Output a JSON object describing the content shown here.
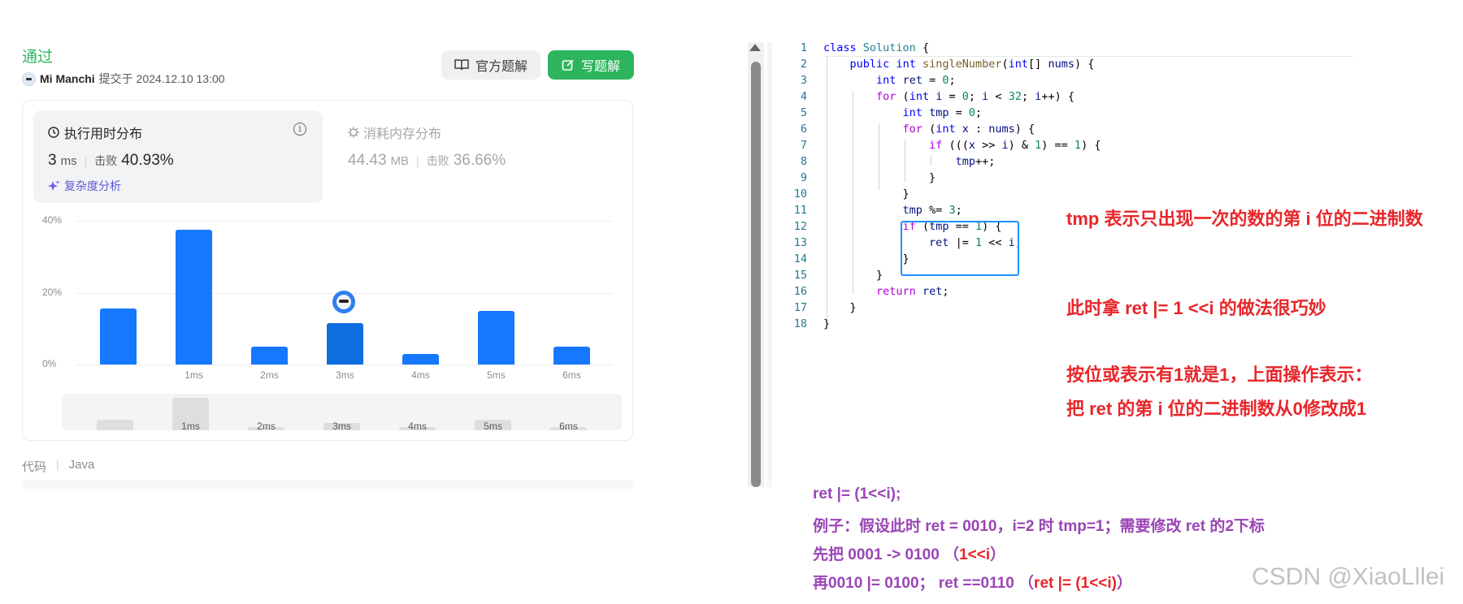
{
  "submission": {
    "status": "通过",
    "author": "Mi Manchi",
    "submitted_at": "提交于 2024.12.10 13:00",
    "official_solution_label": "官方题解",
    "write_solution_label": "写题解"
  },
  "runtime": {
    "title": "执行用时分布",
    "value": "3",
    "unit": "ms",
    "beats_label": "击败",
    "beats_value": "40.93%",
    "complexity_label": "复杂度分析"
  },
  "memory": {
    "title": "消耗内存分布",
    "value": "44.43",
    "unit": "MB",
    "beats_label": "击败",
    "beats_value": "36.66%"
  },
  "chart_data": {
    "type": "bar",
    "categories": [
      "",
      "1ms",
      "2ms",
      "3ms",
      "4ms",
      "5ms",
      "6ms"
    ],
    "values": [
      15.5,
      37.5,
      5,
      11.5,
      3,
      15,
      5
    ],
    "highlighted_category": "3ms",
    "yticks": [
      "40%",
      "20%",
      "0%"
    ],
    "ylim": [
      0,
      40
    ],
    "mini_values": [
      3,
      9,
      1,
      2,
      1,
      3,
      1
    ],
    "grid": true
  },
  "code_meta": {
    "label": "代码",
    "language": "Java"
  },
  "code_lines": [
    "1",
    "2",
    "3",
    "4",
    "5",
    "6",
    "7",
    "8",
    "9",
    "10",
    "11",
    "12",
    "13",
    "14",
    "15",
    "16",
    "17",
    "18"
  ],
  "annotations": {
    "tmp_note": "tmp 表示只出现一次的数的第 i 位的二进制数",
    "trick_note": "此时拿 ret |= 1 <<i 的做法很巧妙",
    "or_note_1": "按位或表示有1就是1，上面操作表示：",
    "or_note_2": "把 ret 的第 i 位的二进制数从0修改成1",
    "ex_line1": "ret |= (1<<i);",
    "ex_line2": "例子：假设此时 ret = 0010，i=2 时 tmp=1；需要修改 ret 的2下标",
    "ex_line3a": "先把 0001 -> 0100   （",
    "ex_line3b": "1<<i",
    "ex_line3c": "）",
    "ex_line4a": "再0010 |= 0100；  ret ==0110 （",
    "ex_line4b": "ret |= (1<<i)",
    "ex_line4c": "）",
    "watermark": "CSDN @XiaoLllei"
  },
  "colors": {
    "accent_green": "#2db55d",
    "bar_blue": "#1677ff",
    "annotation_red": "#e8262a",
    "annotation_purple": "#9a45b5"
  }
}
